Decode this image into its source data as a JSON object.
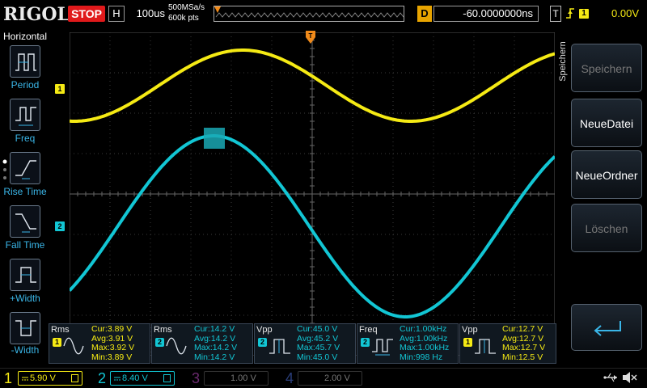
{
  "topbar": {
    "brand": "RIGOL",
    "run_state": "STOP",
    "timebase_label": "H",
    "timebase_value": "100us",
    "sample_rate": "500MSa/s",
    "memory_depth": "600k pts",
    "delay_label": "D",
    "delay_value": "-60.0000000ns",
    "trigger_type": "T",
    "trigger_source": "1",
    "trigger_level": "0.00V"
  },
  "sidebar": {
    "title": "Horizontal",
    "items": [
      {
        "label": "Period",
        "icon": "period-icon"
      },
      {
        "label": "Freq",
        "icon": "freq-icon"
      },
      {
        "label": "Rise Time",
        "icon": "rise-time-icon"
      },
      {
        "label": "Fall Time",
        "icon": "fall-time-icon"
      },
      {
        "label": "+Width",
        "icon": "pos-width-icon"
      },
      {
        "label": "-Width",
        "icon": "neg-width-icon"
      }
    ]
  },
  "right_panel": {
    "title": "Speichern",
    "buttons": [
      {
        "label": "Speichern",
        "enabled": false
      },
      {
        "label": "NeueDatei",
        "enabled": true
      },
      {
        "label": "NeueOrdner",
        "enabled": true
      },
      {
        "label": "Löschen",
        "enabled": false
      }
    ],
    "enter_icon": "enter-arrow-icon"
  },
  "waveform": {
    "markers": {
      "ch1": "1",
      "ch2": "2",
      "trigger": "T"
    }
  },
  "measurements": [
    {
      "name": "Rms",
      "channel": "1",
      "icon": "rms-sine-icon",
      "cur": "Cur:3.89 V",
      "avg": "Avg:3.91 V",
      "max": "Max:3.92 V",
      "min": "Min:3.89 V"
    },
    {
      "name": "Rms",
      "channel": "2",
      "icon": "rms-sine-icon",
      "cur": "Cur:14.2 V",
      "avg": "Avg:14.2 V",
      "max": "Max:14.2 V",
      "min": "Min:14.2 V"
    },
    {
      "name": "Vpp",
      "channel": "2",
      "icon": "vpp-pulse-icon",
      "cur": "Cur:45.0 V",
      "avg": "Avg:45.2 V",
      "max": "Max:45.7 V",
      "min": "Min:45.0 V"
    },
    {
      "name": "Freq",
      "channel": "2",
      "icon": "freq-pulse-icon",
      "cur": "Cur:1.00kHz",
      "avg": "Avg:1.00kHz",
      "max": "Max:1.00kHz",
      "min": "Min:998 Hz"
    },
    {
      "name": "Vpp",
      "channel": "1",
      "icon": "vpp-pulse-icon",
      "cur": "Cur:12.7 V",
      "avg": "Avg:12.7 V",
      "max": "Max:12.7 V",
      "min": "Min:12.5 V"
    }
  ],
  "channels": [
    {
      "num": "1",
      "scale": "5.90 V",
      "active": true
    },
    {
      "num": "2",
      "scale": "8.40 V",
      "active": true
    },
    {
      "num": "3",
      "scale": "1.00 V",
      "active": false
    },
    {
      "num": "4",
      "scale": "2.00 V",
      "active": false
    }
  ],
  "colors": {
    "ch1": "#f5ea14",
    "ch2": "#12c6d4",
    "ch3": "#c020c8",
    "ch4": "#3a68e8",
    "trigger": "#f08a1a",
    "stop": "#e0191b",
    "sidebar_label": "#3ab6e8"
  }
}
